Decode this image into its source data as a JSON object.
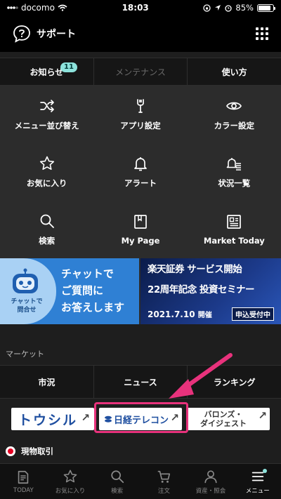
{
  "status": {
    "carrier": "docomo",
    "time": "18:03",
    "battery": "85%"
  },
  "header": {
    "title": "サポート"
  },
  "tabs": [
    {
      "label": "お知らせ",
      "badge": "11"
    },
    {
      "label": "メンテナンス"
    },
    {
      "label": "使い方"
    }
  ],
  "menu": [
    {
      "label": "メニュー並び替え",
      "icon": "shuffle-icon"
    },
    {
      "label": "アプリ設定",
      "icon": "wrench-icon"
    },
    {
      "label": "カラー設定",
      "icon": "eye-icon"
    },
    {
      "label": "お気に入り",
      "icon": "star-icon"
    },
    {
      "label": "アラート",
      "icon": "bell-icon"
    },
    {
      "label": "状況一覧",
      "icon": "bell-list-icon"
    },
    {
      "label": "検索",
      "icon": "search-icon"
    },
    {
      "label": "My Page",
      "icon": "bookmark-icon"
    },
    {
      "label": "Market Today",
      "icon": "newspaper-icon"
    }
  ],
  "banners": {
    "chat": {
      "robot_label": "チャットで\n問合せ",
      "line1": "チャットで",
      "line2": "ご質問に",
      "line3": "お答えします"
    },
    "seminar": {
      "line1": "楽天証券 サービス開始",
      "line2": "22周年記念 投資セミナー",
      "date": "2021.7.10",
      "date_suffix": "開催",
      "status": "申込受付中"
    }
  },
  "market": {
    "heading": "マーケット",
    "tabs": [
      "市況",
      "ニュース",
      "ランキング"
    ],
    "links": [
      {
        "label": "トウシル"
      },
      {
        "label": "日経テレコン"
      },
      {
        "label": "バロンズ・\nダイジェスト"
      }
    ]
  },
  "spot": {
    "label": "現物取引"
  },
  "bottom_nav": [
    {
      "label": "TODAY",
      "icon": "document-icon"
    },
    {
      "label": "お気に入り",
      "icon": "star-icon"
    },
    {
      "label": "検索",
      "icon": "search-icon"
    },
    {
      "label": "注文",
      "icon": "cart-icon"
    },
    {
      "label": "資産・照会",
      "icon": "person-icon"
    },
    {
      "label": "メニュー",
      "icon": "menu-icon",
      "active": true
    }
  ],
  "colors": {
    "accent": "#8de3dc",
    "highlight": "#e8327c",
    "chat_blue": "#2f80d4"
  }
}
